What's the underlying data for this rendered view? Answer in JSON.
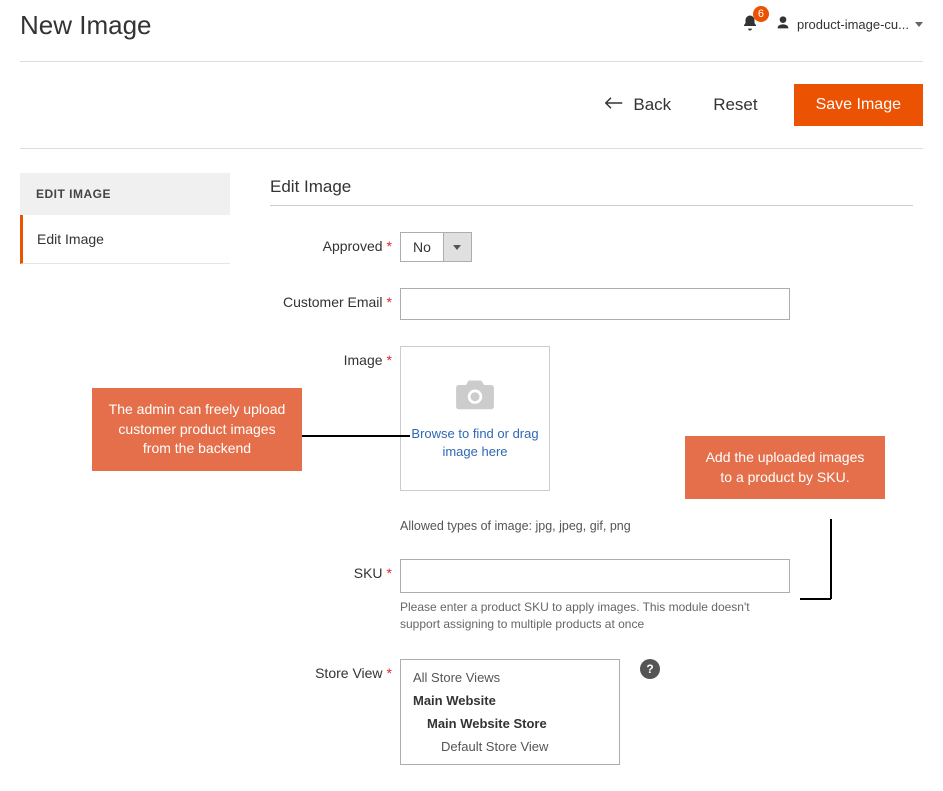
{
  "header": {
    "title": "New Image",
    "notification_count": "6",
    "username": "product-image-cu..."
  },
  "actions": {
    "back": "Back",
    "reset": "Reset",
    "save": "Save Image"
  },
  "sidebar": {
    "header": "EDIT IMAGE",
    "items": [
      "Edit Image"
    ]
  },
  "section": {
    "title": "Edit Image"
  },
  "fields": {
    "approved": {
      "label": "Approved",
      "value": "No"
    },
    "email": {
      "label": "Customer Email",
      "value": ""
    },
    "image": {
      "label": "Image",
      "browse_text": "Browse to find or drag image here",
      "hint": "Allowed types of image: jpg, jpeg, gif, png"
    },
    "sku": {
      "label": "SKU",
      "value": "",
      "hint": "Please enter a product SKU to apply images. This module doesn't support assigning to multiple products at once"
    },
    "storeview": {
      "label": "Store View",
      "options": [
        {
          "text": "All Store Views",
          "bold": false,
          "indent": 0
        },
        {
          "text": "Main Website",
          "bold": true,
          "indent": 0
        },
        {
          "text": "Main Website Store",
          "bold": true,
          "indent": 1
        },
        {
          "text": "Default Store View",
          "bold": false,
          "indent": 2
        }
      ]
    }
  },
  "callouts": {
    "left": "The admin can freely upload customer product images from the backend",
    "right": "Add the uploaded images to a product by SKU."
  },
  "colors": {
    "accent": "#eb5202",
    "callout": "#e46f4a"
  }
}
